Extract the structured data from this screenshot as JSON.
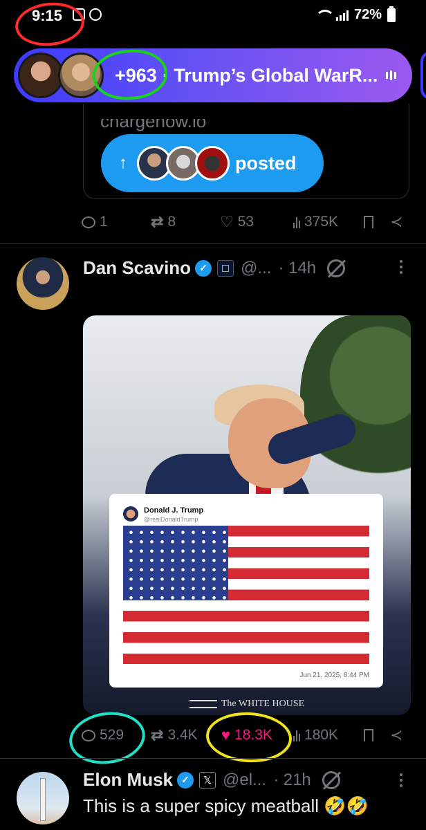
{
  "status_bar": {
    "time": "9:15",
    "battery": "72%"
  },
  "space": {
    "listeners": "+963",
    "title": "· Trump’s Global WarR..."
  },
  "tweet1": {
    "card_url": "chargenow.io",
    "posted_label": "posted",
    "posted_arrow": "↑",
    "replies": "1",
    "retweets": "8",
    "likes": "53",
    "views": "375K"
  },
  "tweet2": {
    "name": "Dan Scavino",
    "handle": "@...",
    "time": "· 14h",
    "embedded": {
      "name": "Donald J. Trump",
      "handle": "@realDonaldTrump",
      "date": "Jun 21, 2025, 8:44 PM",
      "watermark": "The WHITE HOUSE"
    },
    "replies": "529",
    "retweets": "3.4K",
    "likes": "18.3K",
    "views": "180K"
  },
  "tweet3": {
    "name": "Elon Musk",
    "handle": "@el...",
    "time": "· 21h",
    "text": "This is a super spicy meatball 🤣🤣"
  },
  "colors": {
    "accent": "#1d9bf0",
    "like": "#f91880",
    "annotation_red": "#ff2a2a",
    "annotation_green": "#19d319",
    "annotation_cyan": "#22e0c8",
    "annotation_yellow": "#f1e21a"
  },
  "icons": [
    "reply-icon",
    "retweet-icon",
    "heart-icon",
    "views-icon",
    "bookmark-icon",
    "share-icon",
    "verified-icon",
    "grok-icon",
    "more-icon"
  ]
}
